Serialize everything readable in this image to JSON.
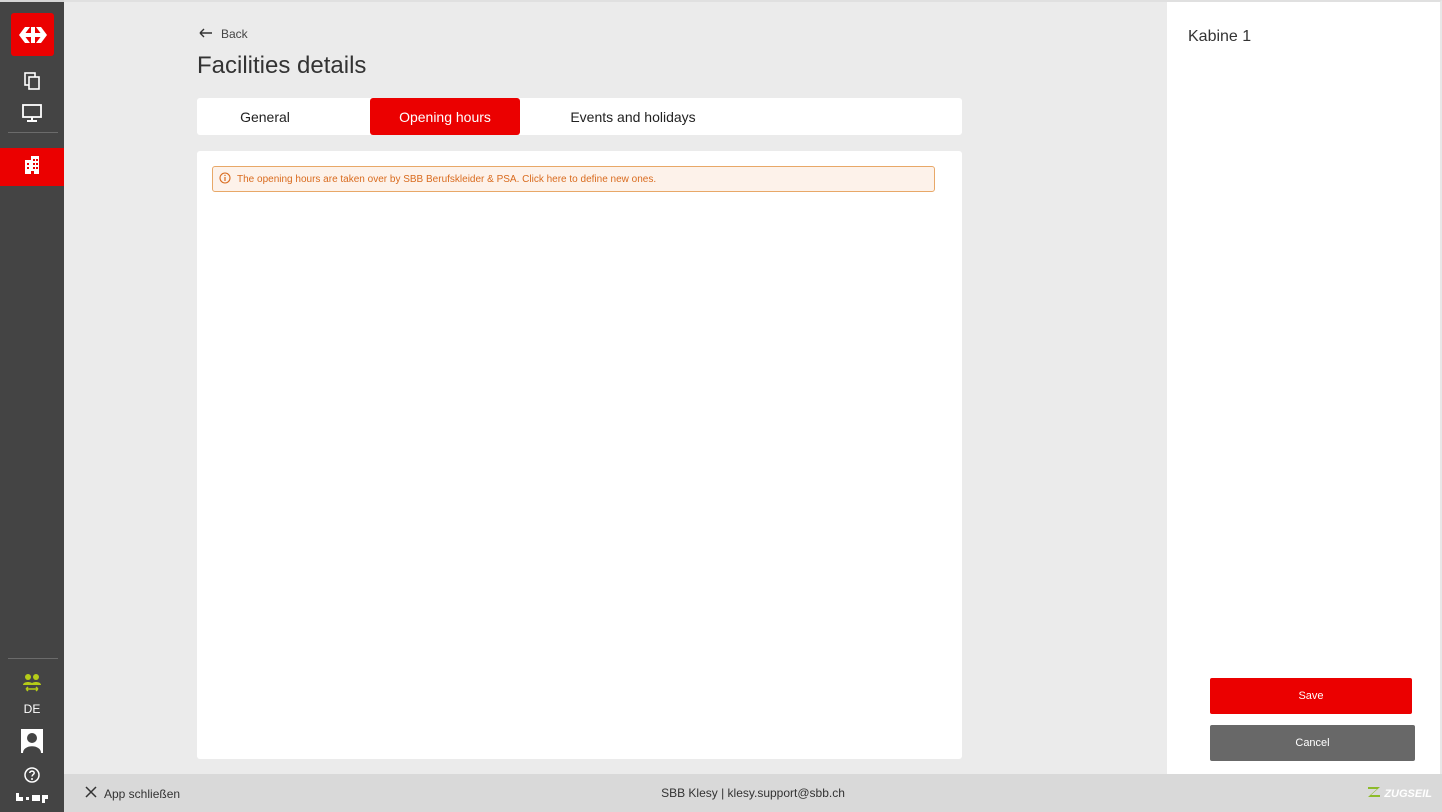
{
  "sidebar": {
    "language": "DE",
    "icons": [
      "sbb-logo-icon",
      "copy-icon",
      "monitor-icon",
      "building-icon",
      "users-transfer-icon",
      "user-avatar-icon",
      "help-icon",
      "bmp-logo-icon"
    ]
  },
  "header": {
    "back_label": "Back",
    "title": "Facilities details"
  },
  "tabs": [
    {
      "label": "General",
      "active": false
    },
    {
      "label": "Opening hours",
      "active": true
    },
    {
      "label": "Events and holidays",
      "active": false
    }
  ],
  "notice": {
    "text": "The opening hours are taken over by SBB Berufskleider & PSA. Click here to define new ones."
  },
  "right_panel": {
    "title": "Kabine 1",
    "save_label": "Save",
    "cancel_label": "Cancel"
  },
  "footer": {
    "close_label": "App schließen",
    "center_text": "SBB Klesy | klesy.support@sbb.ch",
    "brand": "ZUGSEIL"
  },
  "colors": {
    "accent": "#eb0000",
    "sidebar": "#444444",
    "notice_text": "#d96b1e",
    "notice_bg": "#fdf2ea",
    "cancel": "#686868"
  }
}
